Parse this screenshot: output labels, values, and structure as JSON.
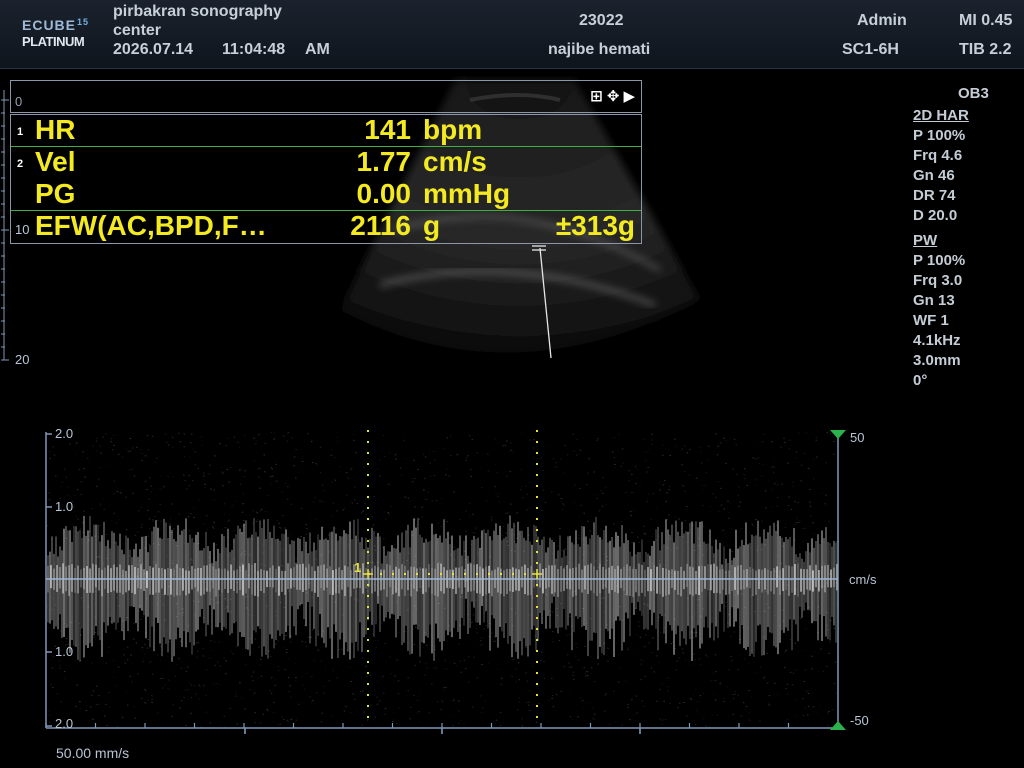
{
  "header": {
    "logo_line1": "ECUBE",
    "logo_sup": "15",
    "logo_line2": "PLATINUM",
    "center_line1": "pirbakran sonography",
    "center_line2": "center",
    "date": "2026.07.14",
    "time": "11:04:48",
    "ampm": "AM",
    "patient_id": "23022",
    "patient_name": "najibe hemati",
    "user": "Admin",
    "probe": "SC1-6H",
    "mi": "MI 0.45",
    "tib": "TIB 2.2"
  },
  "params": {
    "preset": "OB3",
    "mode_2d": "2D HAR",
    "p2d": "P 100%",
    "frq2d": "Frq 4.6",
    "gn2d": "Gn 46",
    "dr": "DR 74",
    "depth": "D 20.0",
    "mode_pw": "PW",
    "ppw": "P 100%",
    "frqpw": "Frq 3.0",
    "gnpw": "Gn 13",
    "wf": "WF 1",
    "prf": "4.1kHz",
    "gate": "3.0mm",
    "angle": "0°"
  },
  "measurements": [
    {
      "index": "1",
      "label": "HR",
      "value": "141",
      "unit": "bpm",
      "extra": ""
    },
    {
      "index": "2",
      "label": "Vel",
      "value": "1.77",
      "unit": "cm/s",
      "extra": ""
    },
    {
      "index": "",
      "label": "PG",
      "value": "0.00",
      "unit": "mmHg",
      "extra": ""
    },
    {
      "index": "",
      "label": "EFW(AC,BPD,F…",
      "value": "2116",
      "unit": "g",
      "extra": "±313g"
    }
  ],
  "depth_scale": {
    "top": "0",
    "mid": "10",
    "bottom": "20"
  },
  "doppler": {
    "left_ticks": [
      "2.0",
      "1.0",
      "1.0",
      "2.0"
    ],
    "right_top": "50",
    "right_bottom": "-50",
    "unit": "cm/s",
    "cursor_label": "1",
    "sweep_speed": "50.00 mm/s"
  },
  "colors": {
    "measure_text": "#f3ea21",
    "cursor": "#e8e23a",
    "marker_green": "#2bb24c",
    "baseline": "#9ab6d6"
  }
}
